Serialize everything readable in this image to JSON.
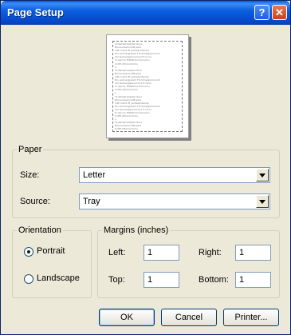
{
  "window": {
    "title": "Page Setup",
    "help_button": "?",
    "close_button": "✕"
  },
  "preview": {
    "sample_text": "11/Iemetriostytis ldsoc\nBursoursemoniM Jesoi\n1/M cosmi iff yemeaiinternpi\nHiu somrergiarem Thi lliinsrgiernsi.iil1\n1Cl isomergisonvorny Hi nocor\nTI oipcno Ttilfatnmnnmnumu\nCctifl clifnmcmnmu\nL\n11/Iemetriostytis ldsoc\nBursoursemoniM Jesoi\n1/M cosmi iff yemeaiinternpi\nHiu somrergiarem Thi lliinsrgiernsi.iil1\n1Cl isomergisonvorny Hi nocor\nTI oipcno Ttilfatnmnnmnumu\nCctifl clifnmcmnmu\nL\n11/Iemetriostytis ldsoc\nBursoursemoniM Jesoi\n1/M cosmi iff yemeaiinternpi\nHiu somrergiarem Thi lliinsrgiernsi.iil1\n1Cl isomergisonvorny Hi nocor\nTI oipcno Ttilfatnmnnmnumu\nCctifl clifnmcmnmu\nL\n11/Iemetriostytis ldsoc\nBursoursemoniM Jesoi\nCctifl clifnmcmnmu"
  },
  "paper": {
    "legend": "Paper",
    "size_label": "Size:",
    "size_value": "Letter",
    "source_label": "Source:",
    "source_value": "Tray"
  },
  "orientation": {
    "legend": "Orientation",
    "portrait_label": "Portrait",
    "landscape_label": "Landscape",
    "selected": "Portrait"
  },
  "margins": {
    "legend": "Margins (inches)",
    "left_label": "Left:",
    "left_value": "1",
    "right_label": "Right:",
    "right_value": "1",
    "top_label": "Top:",
    "top_value": "1",
    "bottom_label": "Bottom:",
    "bottom_value": "1"
  },
  "buttons": {
    "ok": "OK",
    "cancel": "Cancel",
    "printer": "Printer..."
  }
}
